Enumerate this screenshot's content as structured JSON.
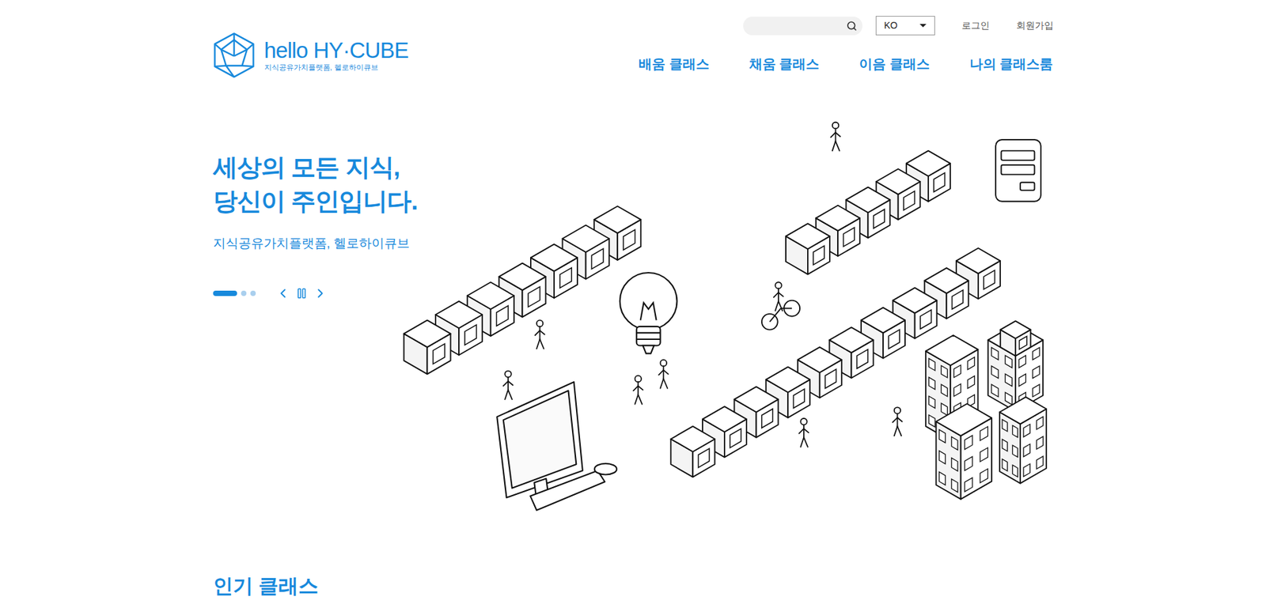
{
  "header": {
    "logo": {
      "title": "hello HY·CUBE",
      "subtitle": "지식공유가치플랫폼, 헬로하이큐브"
    },
    "search": {
      "placeholder": ""
    },
    "language": {
      "value": "KO"
    },
    "links": [
      "로그인",
      "회원가입"
    ]
  },
  "nav": [
    {
      "label": "배움 클래스"
    },
    {
      "label": "채움 클래스"
    },
    {
      "label": "이음 클래스"
    },
    {
      "label": "나의 클래스룸"
    }
  ],
  "hero": {
    "title_lines": [
      "세상의 모든 지식,",
      "당신이 주인입니다."
    ],
    "subtitle": "지식공유가치플랫폼, 헬로하이큐브",
    "slides": [
      {
        "selected": true
      },
      {
        "selected": false
      },
      {
        "selected": false
      }
    ],
    "paused": false
  },
  "popular": {
    "title": "인기 클래스"
  }
}
